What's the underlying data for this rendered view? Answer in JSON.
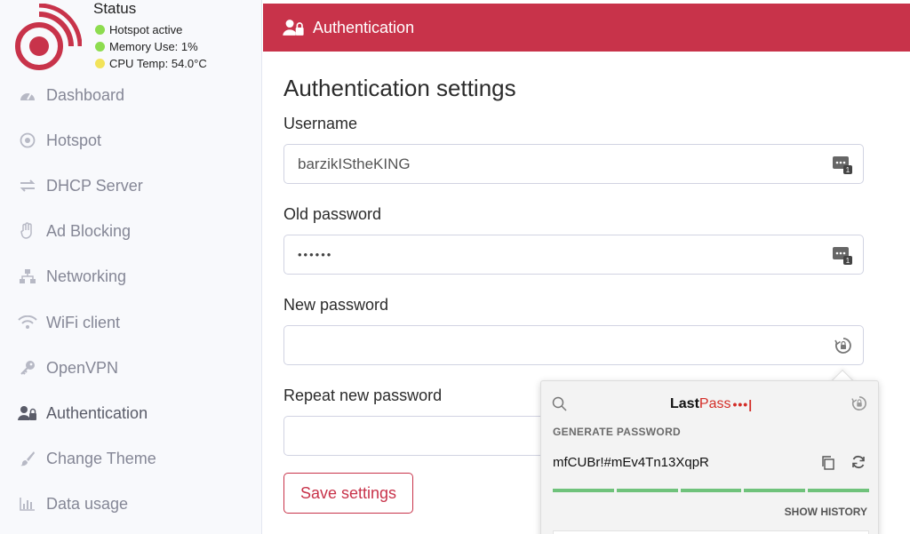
{
  "status": {
    "title": "Status",
    "lines": [
      {
        "text": "Hotspot active",
        "color": "#8ddc4f"
      },
      {
        "text": "Memory Use: 1%",
        "color": "#8ddc4f"
      },
      {
        "text": "CPU Temp: 54.0°C",
        "color": "#f2e35a"
      }
    ]
  },
  "sidebar": {
    "items": [
      {
        "label": "Dashboard",
        "icon": "tachometer-icon"
      },
      {
        "label": "Hotspot",
        "icon": "dot-circle-icon"
      },
      {
        "label": "DHCP Server",
        "icon": "exchange-icon"
      },
      {
        "label": "Ad Blocking",
        "icon": "hand-icon"
      },
      {
        "label": "Networking",
        "icon": "network-icon"
      },
      {
        "label": "WiFi client",
        "icon": "wifi-icon"
      },
      {
        "label": "OpenVPN",
        "icon": "key-icon"
      },
      {
        "label": "Authentication",
        "icon": "user-lock-icon",
        "active": true
      },
      {
        "label": "Change Theme",
        "icon": "paint-brush-icon"
      },
      {
        "label": "Data usage",
        "icon": "bar-chart-icon"
      }
    ]
  },
  "header": {
    "title": "Authentication",
    "color": "#c8334a"
  },
  "main": {
    "title": "Authentication settings",
    "username_label": "Username",
    "username_value": "barzikIStheKING",
    "old_password_label": "Old password",
    "old_password_value": "••••••",
    "new_password_label": "New password",
    "repeat_password_label": "Repeat new password",
    "save_label": "Save settings"
  },
  "lastpass": {
    "logo_last": "Last",
    "logo_pass": "Pass",
    "logo_dots": "•••|",
    "section_label": "GENERATE PASSWORD",
    "generated_password": "mfCUBr!#mEv4Tn13XqpR",
    "show_history": "SHOW HISTORY"
  }
}
